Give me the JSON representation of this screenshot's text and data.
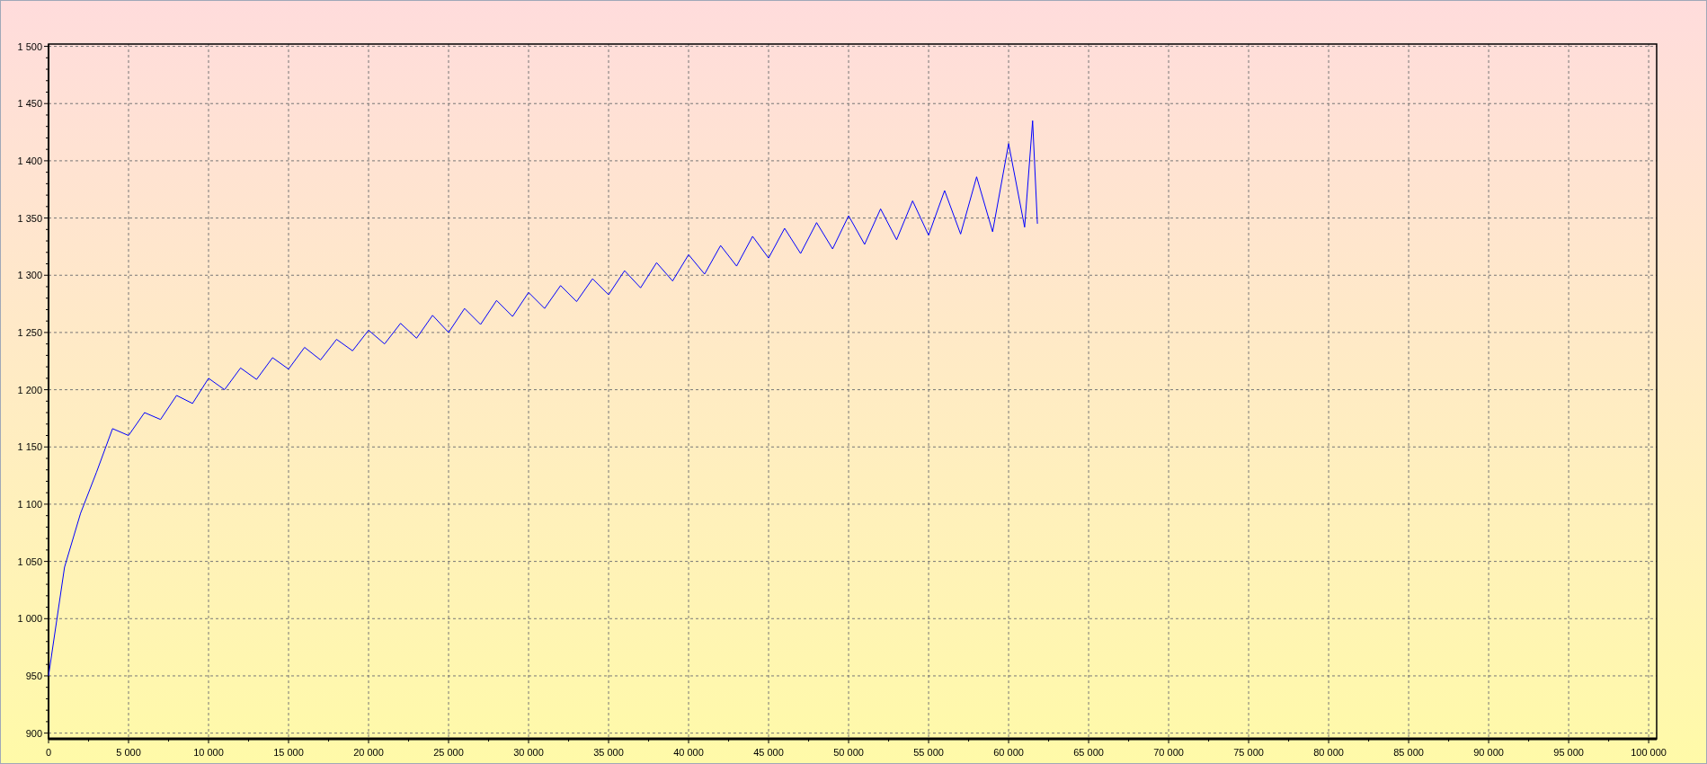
{
  "chart_data": {
    "type": "line",
    "x": [
      0,
      1000,
      2000,
      3000,
      4000,
      5000,
      6000,
      7000,
      8000,
      9000,
      10000,
      11000,
      12000,
      13000,
      14000,
      15000,
      16000,
      17000,
      18000,
      19000,
      20000,
      21000,
      22000,
      23000,
      24000,
      25000,
      26000,
      27000,
      28000,
      29000,
      30000,
      31000,
      32000,
      33000,
      34000,
      35000,
      36000,
      37000,
      38000,
      39000,
      40000,
      41000,
      42000,
      43000,
      44000,
      45000,
      46000,
      47000,
      48000,
      49000,
      50000,
      51000,
      52000,
      53000,
      54000,
      55000,
      56000,
      57000,
      58000,
      59000,
      60000,
      61000,
      61500,
      61800
    ],
    "series": [
      {
        "color": "#0000ff",
        "values": [
          950,
          1045,
          1092,
          1128,
          1166,
          1160,
          1180,
          1174,
          1195,
          1188,
          1210,
          1200,
          1219,
          1209,
          1228,
          1218,
          1237,
          1226,
          1244,
          1234,
          1252,
          1240,
          1258,
          1245,
          1265,
          1250,
          1271,
          1257,
          1278,
          1264,
          1285,
          1271,
          1291,
          1277,
          1297,
          1283,
          1304,
          1289,
          1311,
          1295,
          1318,
          1301,
          1326,
          1308,
          1334,
          1315,
          1341,
          1319,
          1346,
          1323,
          1352,
          1327,
          1358,
          1331,
          1365,
          1335,
          1374,
          1336,
          1386,
          1338,
          1415,
          1342,
          1435,
          1345
        ]
      }
    ],
    "grid": true,
    "xlim": [
      0,
      100500
    ],
    "ylim": [
      895,
      1502
    ],
    "xticks": [
      {
        "value": 0,
        "label": "0"
      },
      {
        "value": 5000,
        "label": "5 000"
      },
      {
        "value": 10000,
        "label": "10 000"
      },
      {
        "value": 15000,
        "label": "15 000"
      },
      {
        "value": 20000,
        "label": "20 000"
      },
      {
        "value": 25000,
        "label": "25 000"
      },
      {
        "value": 30000,
        "label": "30 000"
      },
      {
        "value": 35000,
        "label": "35 000"
      },
      {
        "value": 40000,
        "label": "40 000"
      },
      {
        "value": 45000,
        "label": "45 000"
      },
      {
        "value": 50000,
        "label": "50 000"
      },
      {
        "value": 55000,
        "label": "55 000"
      },
      {
        "value": 60000,
        "label": "60 000"
      },
      {
        "value": 65000,
        "label": "65 000"
      },
      {
        "value": 70000,
        "label": "70 000"
      },
      {
        "value": 75000,
        "label": "75 000"
      },
      {
        "value": 80000,
        "label": "80 000"
      },
      {
        "value": 85000,
        "label": "85 000"
      },
      {
        "value": 90000,
        "label": "90 000"
      },
      {
        "value": 95000,
        "label": "95 000"
      },
      {
        "value": 100000,
        "label": "100 000"
      }
    ],
    "yticks": [
      {
        "value": 900,
        "label": "900"
      },
      {
        "value": 950,
        "label": "950"
      },
      {
        "value": 1000,
        "label": "1 000"
      },
      {
        "value": 1050,
        "label": "1 050"
      },
      {
        "value": 1100,
        "label": "1 100"
      },
      {
        "value": 1150,
        "label": "1 150"
      },
      {
        "value": 1200,
        "label": "1 200"
      },
      {
        "value": 1250,
        "label": "1 250"
      },
      {
        "value": 1300,
        "label": "1 300"
      },
      {
        "value": 1350,
        "label": "1 350"
      },
      {
        "value": 1400,
        "label": "1 400"
      },
      {
        "value": 1450,
        "label": "1 450"
      },
      {
        "value": 1500,
        "label": "1 500"
      }
    ]
  }
}
